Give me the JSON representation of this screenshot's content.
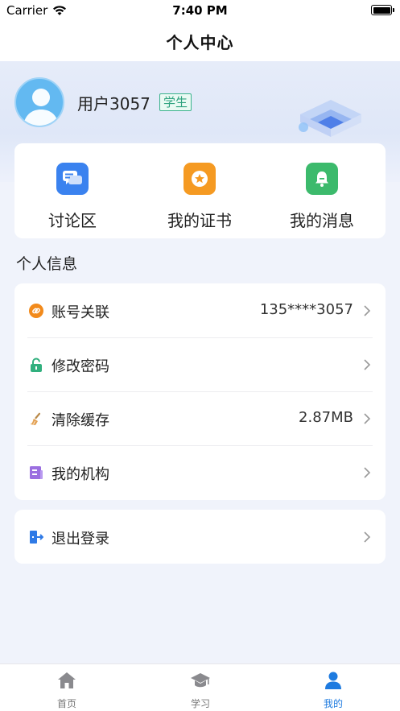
{
  "status_bar": {
    "carrier": "Carrier",
    "time": "7:40 PM"
  },
  "nav": {
    "title": "个人中心"
  },
  "profile": {
    "username": "用户3057",
    "role": "学生"
  },
  "shortcuts": [
    {
      "label": "讨论区",
      "icon": "chat-bubbles-icon",
      "color": "#3a82ef"
    },
    {
      "label": "我的证书",
      "icon": "certificate-icon",
      "color": "#f59a22"
    },
    {
      "label": "我的消息",
      "icon": "bell-icon",
      "color": "#3cba6c"
    }
  ],
  "section": {
    "title": "个人信息"
  },
  "settings": [
    {
      "label": "账号关联",
      "value": "135****3057",
      "icon": "link-icon",
      "color": "#f28a1b"
    },
    {
      "label": "修改密码",
      "value": "",
      "icon": "lock-icon",
      "color": "#31b07e"
    },
    {
      "label": "清除缓存",
      "value": "2.87MB",
      "icon": "broom-icon",
      "color": "#e3a153"
    },
    {
      "label": "我的机构",
      "value": "",
      "icon": "organization-icon",
      "color": "#9b6fe0"
    }
  ],
  "logout": {
    "label": "退出登录",
    "icon": "logout-icon",
    "color": "#2f7ae6"
  },
  "tabs": [
    {
      "label": "首页",
      "icon": "home-icon",
      "active": false
    },
    {
      "label": "学习",
      "icon": "graduation-cap-icon",
      "active": false
    },
    {
      "label": "我的",
      "icon": "user-icon",
      "active": true
    }
  ],
  "colors": {
    "accent": "#1e7be0",
    "page_bg": "#f0f3fb"
  }
}
